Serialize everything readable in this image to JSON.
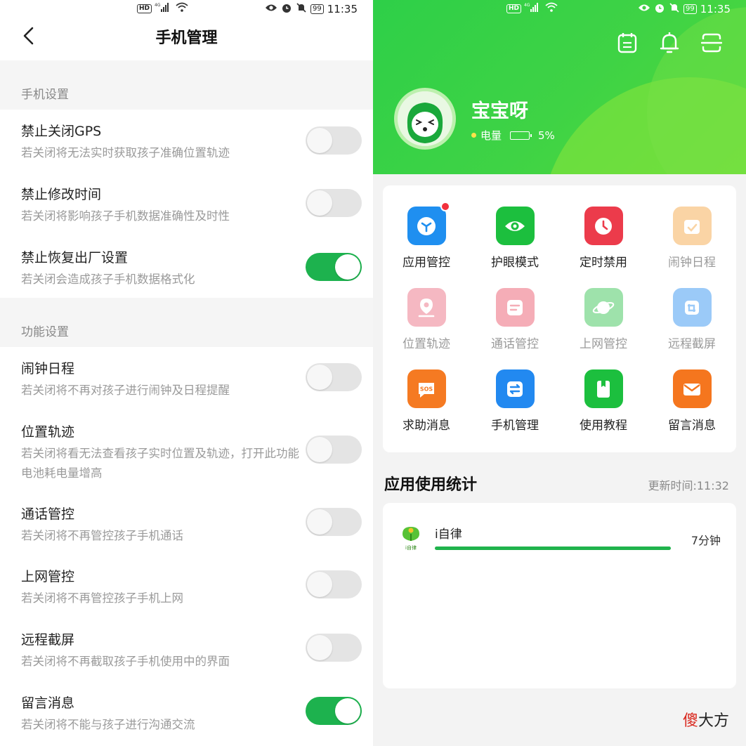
{
  "left": {
    "status_bar": {
      "hd": "HD",
      "network": "4G",
      "battery": "99",
      "time": "11:35"
    },
    "nav": {
      "title": "手机管理",
      "back_icon": "chevron-left-icon"
    },
    "sections": [
      {
        "title": "手机设置",
        "items": [
          {
            "title": "禁止关闭GPS",
            "desc": "若关闭将无法实时获取孩子准确位置轨迹",
            "on": false
          },
          {
            "title": "禁止修改时间",
            "desc": "若关闭将影响孩子手机数据准确性及时性",
            "on": false
          },
          {
            "title": "禁止恢复出厂设置",
            "desc": "若关闭会造成孩子手机数据格式化",
            "on": true
          }
        ]
      },
      {
        "title": "功能设置",
        "items": [
          {
            "title": "闹钟日程",
            "desc": "若关闭将不再对孩子进行闹钟及日程提醒",
            "on": false
          },
          {
            "title": "位置轨迹",
            "desc": "若关闭将看无法查看孩子实时位置及轨迹，打开此功能电池耗电量增高",
            "on": false
          },
          {
            "title": "通话管控",
            "desc": "若关闭将不再管控孩子手机通话",
            "on": false
          },
          {
            "title": "上网管控",
            "desc": "若关闭将不再管控孩子手机上网",
            "on": false
          },
          {
            "title": "远程截屏",
            "desc": "若关闭将不再截取孩子手机使用中的界面",
            "on": false
          },
          {
            "title": "留言消息",
            "desc": "若关闭将不能与孩子进行沟通交流",
            "on": true
          }
        ]
      }
    ]
  },
  "right": {
    "status_bar": {
      "hd": "HD",
      "network": "4G",
      "battery": "99",
      "time": "11:35"
    },
    "header_icons": [
      "calendar-icon",
      "bell-icon",
      "scan-icon"
    ],
    "profile": {
      "name": "宝宝呀",
      "battery_label": "电量",
      "battery_value": "5%"
    },
    "grid": [
      {
        "label": "应用管控",
        "icon": "cube-icon",
        "color": "#1f8ff0",
        "badge": true,
        "dim": false
      },
      {
        "label": "护眼模式",
        "icon": "eye-icon",
        "color": "#1cbf3e",
        "badge": false,
        "dim": false
      },
      {
        "label": "定时禁用",
        "icon": "clock-icon",
        "color": "#ec3b4b",
        "badge": false,
        "dim": false
      },
      {
        "label": "闹钟日程",
        "icon": "calendar-check-icon",
        "color": "#f8b86a",
        "badge": false,
        "dim": true
      },
      {
        "label": "位置轨迹",
        "icon": "location-icon",
        "color": "#f08a9a",
        "badge": false,
        "dim": true
      },
      {
        "label": "通话管控",
        "icon": "message-icon",
        "color": "#f07888",
        "badge": false,
        "dim": true
      },
      {
        "label": "上网管控",
        "icon": "planet-icon",
        "color": "#5fcf74",
        "badge": false,
        "dim": true
      },
      {
        "label": "远程截屏",
        "icon": "screenshot-icon",
        "color": "#5aa8f5",
        "badge": false,
        "dim": true
      },
      {
        "label": "求助消息",
        "icon": "sos-icon",
        "color": "#f57a22",
        "badge": false,
        "dim": false
      },
      {
        "label": "手机管理",
        "icon": "swap-icon",
        "color": "#2289f0",
        "badge": false,
        "dim": false
      },
      {
        "label": "使用教程",
        "icon": "book-icon",
        "color": "#1cbf3e",
        "badge": false,
        "dim": false
      },
      {
        "label": "留言消息",
        "icon": "mail-icon",
        "color": "#f5761e",
        "badge": false,
        "dim": false
      }
    ],
    "stats": {
      "title": "应用使用统计",
      "update_label": "更新时间:11:32",
      "apps": [
        {
          "name": "i自律",
          "icon_text": "i自律",
          "duration": "7分钟",
          "share": 1.0
        }
      ]
    }
  },
  "watermark": {
    "part1": "傻",
    "part2": "大方"
  }
}
